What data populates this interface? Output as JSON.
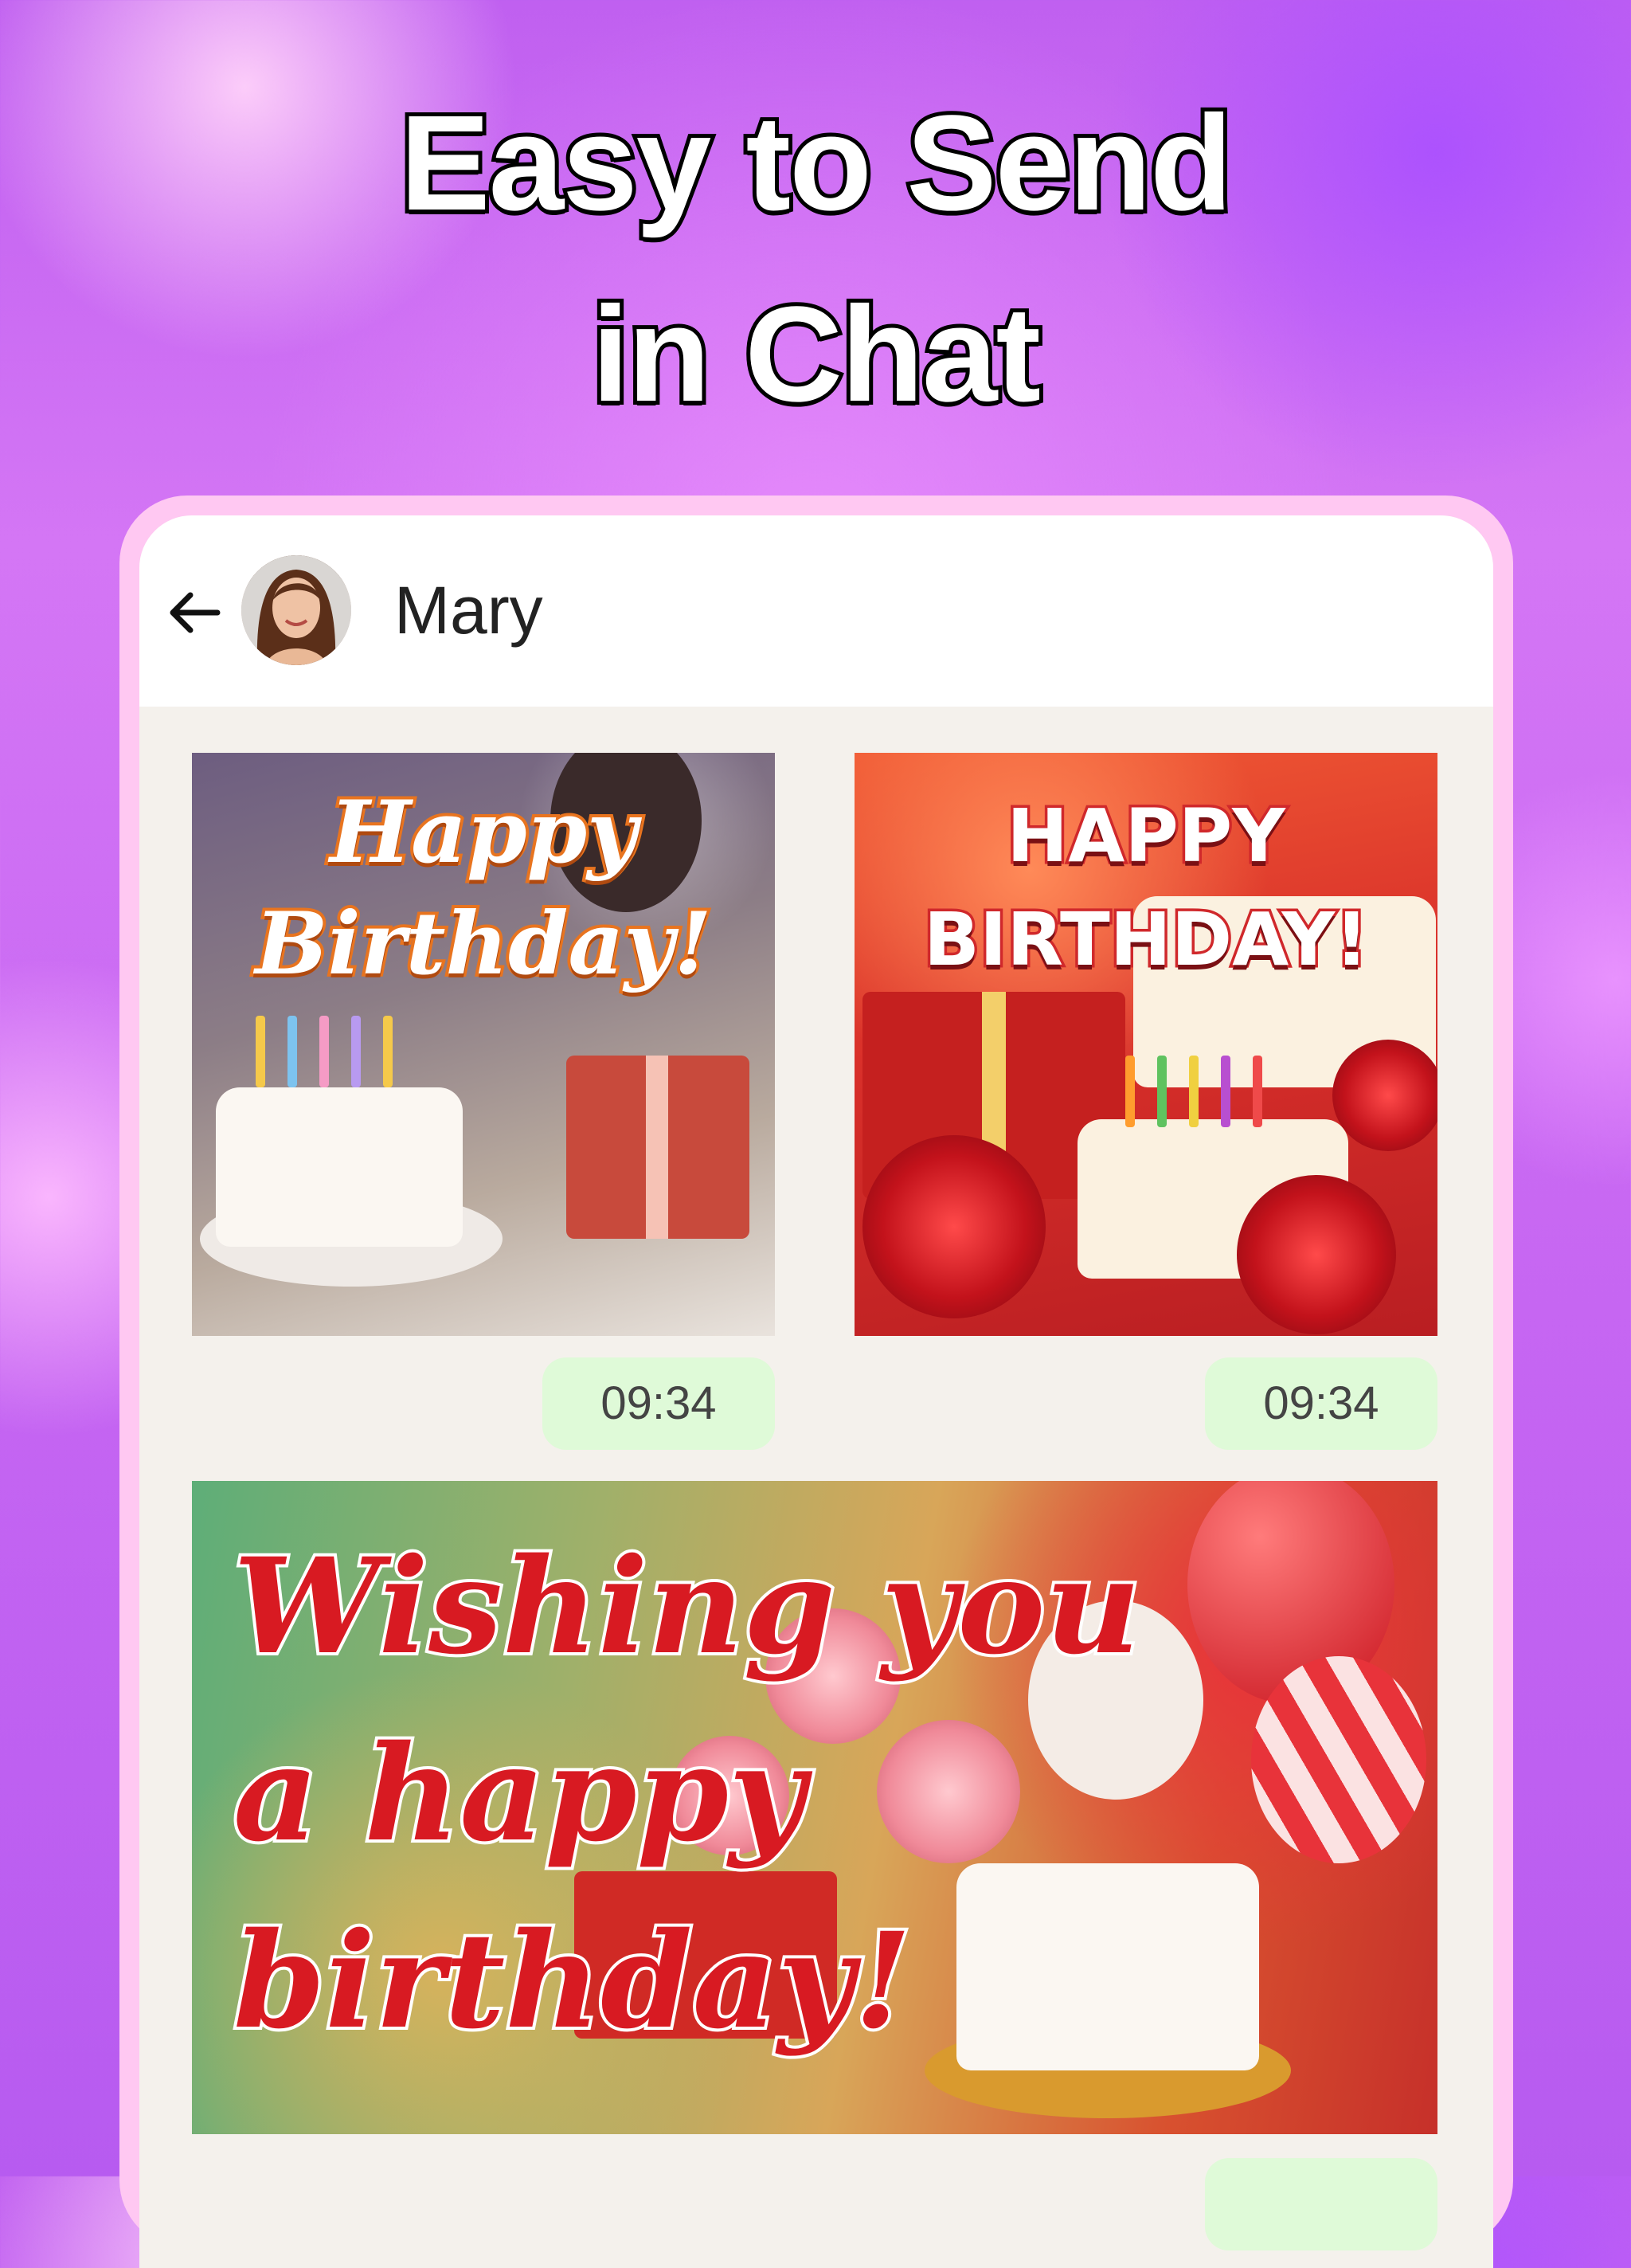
{
  "headline": {
    "line1": "Easy to Send",
    "line2": "in Chat"
  },
  "chat": {
    "contact_name": "Mary",
    "back_icon": "arrow-left-icon"
  },
  "messages": [
    {
      "card_lines": [
        "Happy",
        "Birthday!"
      ],
      "time": "09:34"
    },
    {
      "card_lines": [
        "HAPPY",
        "BIRTHDAY!"
      ],
      "time": "09:34"
    },
    {
      "card_lines": [
        "Wishing you",
        "a happy",
        "birthday!"
      ],
      "time": ""
    }
  ],
  "colors": {
    "accent_bubble": "#dffad8",
    "phone_frame": "#ffc8f2",
    "background": "#c060f0"
  }
}
